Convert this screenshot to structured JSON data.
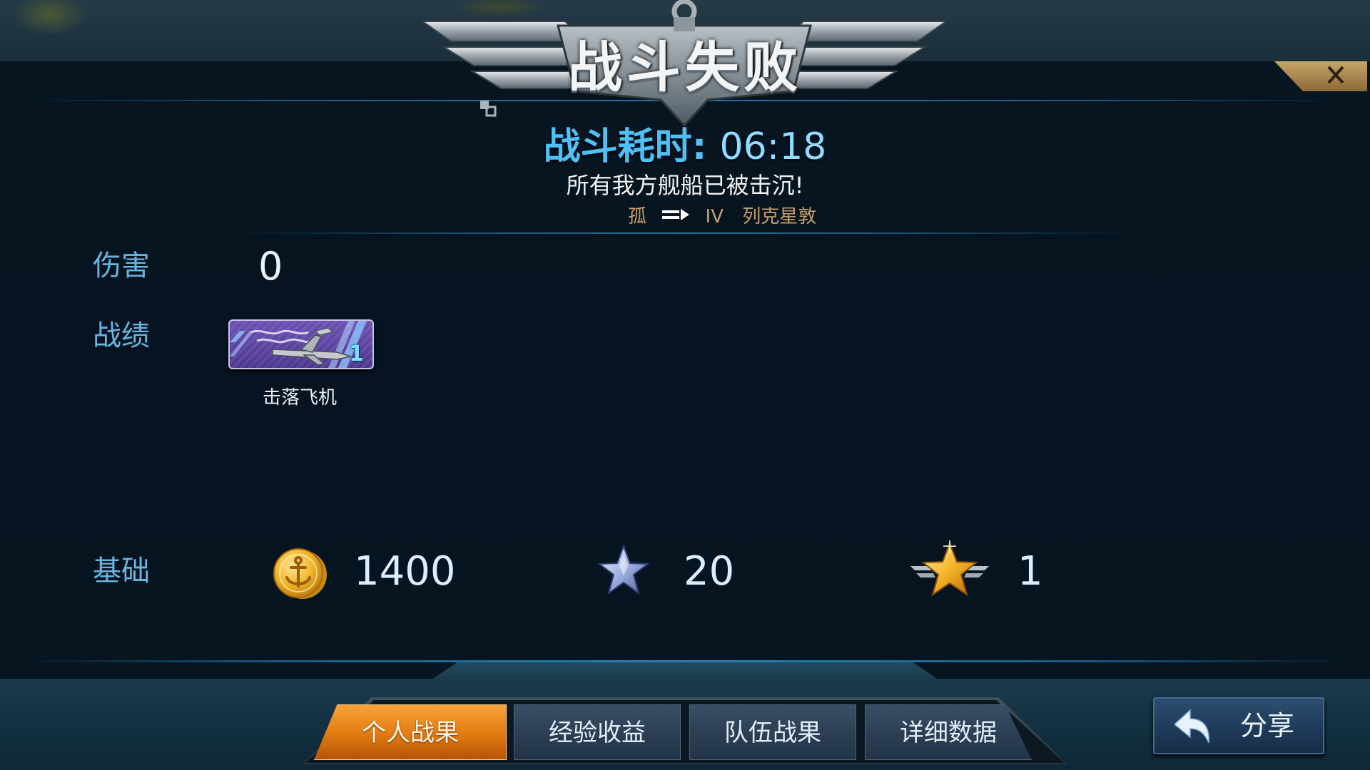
{
  "header": {
    "title": "战斗失败",
    "close_icon": "close-icon"
  },
  "summary": {
    "duration_label": "战斗耗时:",
    "duration_value": "06:18",
    "message": "所有我方舰船已被击沉!",
    "ship": {
      "left_text": "孤",
      "tier": "IV",
      "name": "列克星敦"
    }
  },
  "stats": {
    "damage": {
      "label": "伤害",
      "value": "0"
    },
    "achievements": {
      "label": "战绩",
      "medals": [
        {
          "count": "1",
          "caption": "击落飞机",
          "icon": "shot-down-aircraft-icon"
        }
      ]
    },
    "base": {
      "label": "基础",
      "coins": {
        "icon": "anchor-coin-icon",
        "value": "1400"
      },
      "exp": {
        "icon": "silver-star-icon",
        "value": "20"
      },
      "rank": {
        "icon": "winged-gold-star-icon",
        "value": "1"
      }
    }
  },
  "tabs": [
    {
      "label": "个人战果",
      "active": true
    },
    {
      "label": "经验收益",
      "active": false
    },
    {
      "label": "队伍战果",
      "active": false
    },
    {
      "label": "详细数据",
      "active": false
    }
  ],
  "share": {
    "label": "分享",
    "icon": "share-arrow-icon"
  },
  "colors": {
    "accent_blue": "#46b8f0",
    "label_blue": "#6ab4e0",
    "ship_gold": "#c8a066",
    "active_tab_orange": "#e17a10"
  }
}
